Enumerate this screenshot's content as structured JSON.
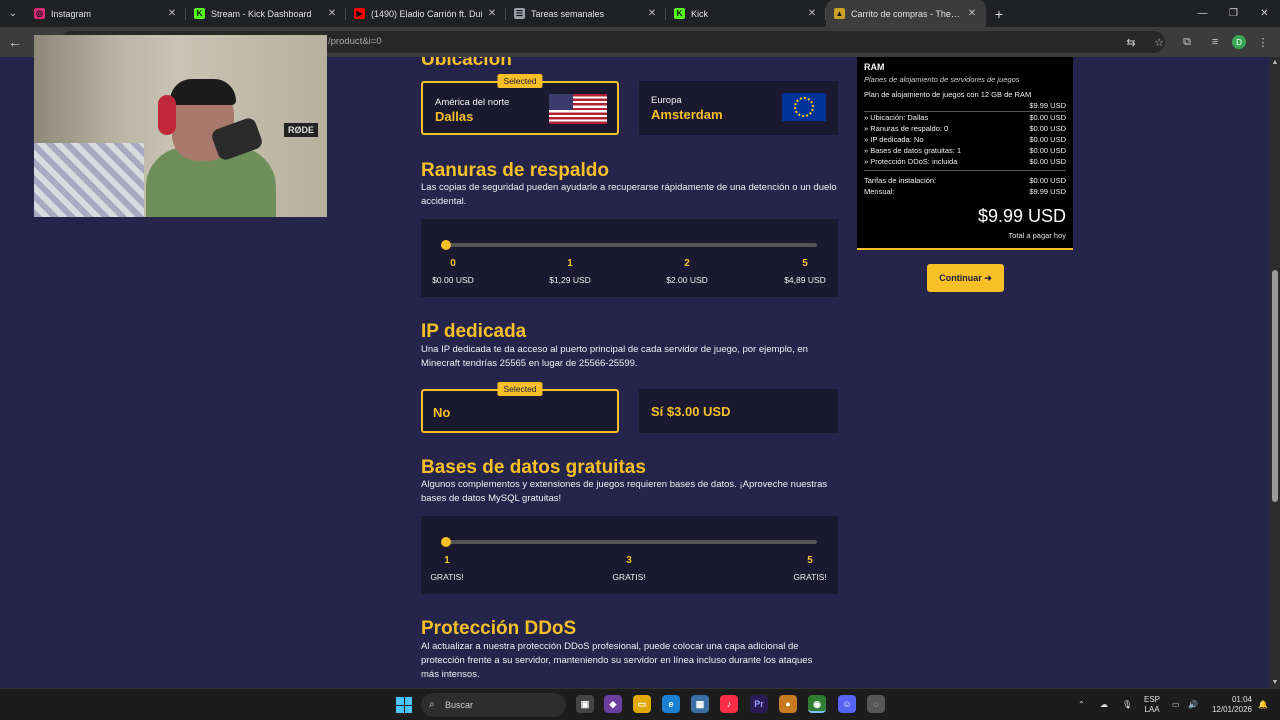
{
  "browser": {
    "tabs": [
      {
        "title": "Instagram",
        "favicon_color": "#d62976",
        "favicon_glyph": "◎",
        "active": false
      },
      {
        "title": "Stream - Kick Dashboard",
        "favicon_color": "#53fc18",
        "favicon_glyph": "K",
        "active": false
      },
      {
        "title": "(1490) Eladio Carrión ft. Dui",
        "favicon_color": "#ff0000",
        "favicon_glyph": "▶",
        "active": false
      },
      {
        "title": "Tareas semanales",
        "favicon_color": "#9aa0a6",
        "favicon_glyph": "☰",
        "active": false
      },
      {
        "title": "Kick",
        "favicon_color": "#53fc18",
        "favicon_glyph": "K",
        "active": false
      },
      {
        "title": "Carrito de compras - TheGame",
        "favicon_color": "#c9a227",
        "favicon_glyph": "▲",
        "active": true
      }
    ],
    "url": "/product&i=0",
    "profile_initial": "D"
  },
  "ubicacion": {
    "heading": "Ubicación",
    "selected_badge": "Selected",
    "options": [
      {
        "region": "América del norte",
        "city": "Dallas",
        "flag": "us-flag",
        "selected": true
      },
      {
        "region": "Europa",
        "city": "Amsterdam",
        "flag": "eu-flag",
        "selected": false
      }
    ]
  },
  "respaldo": {
    "heading": "Ranuras de respaldo",
    "description": "Las copias de seguridad pueden ayudarle a recuperarse rápidamente de una detención o un duelo accidental.",
    "selected_value": "0",
    "ticks": [
      {
        "num": "0",
        "price": "$0.00 USD"
      },
      {
        "num": "1",
        "price": "$1,29 USD"
      },
      {
        "num": "2",
        "price": "$2.00 USD"
      },
      {
        "num": "5",
        "price": "$4,89 USD"
      }
    ]
  },
  "ip": {
    "heading": "IP dedicada",
    "description": "Una IP dedicada te da acceso al puerto principal de cada servidor de juego, por ejemplo, en Minecraft tendrías 25565 en lugar de 25566-25599.",
    "selected_badge": "Selected",
    "options": [
      {
        "label": "No",
        "selected": true
      },
      {
        "label": "Sí $3.00 USD",
        "selected": false
      }
    ]
  },
  "bases": {
    "heading": "Bases de datos gratuitas",
    "description": "Algunos complementos y extensiones de juegos requieren bases de datos. ¡Aproveche nuestras bases de datos MySQL gratuitas!",
    "selected_value": "1",
    "ticks": [
      {
        "num": "1",
        "price": "GRATIS!"
      },
      {
        "num": "3",
        "price": "GRATIS!"
      },
      {
        "num": "5",
        "price": "GRATIS!"
      }
    ]
  },
  "ddos": {
    "heading": "Protección DDoS",
    "description": "Al actualizar a nuestra protección DDoS profesional, puede colocar una capa adicional de protección frente a su servidor, manteniendo su servidor en línea incluso durante los ataques más intensos."
  },
  "summary": {
    "ram": "RAM",
    "subtitle": "Planes de alojamiento de servidores de juegos",
    "plan": "Plan de alojamiento de juegos con 12 GB de RAM",
    "plan_price": "$9.99 USD",
    "items": [
      {
        "label": "» Ubicación: Dallas",
        "price": "$0.00 USD"
      },
      {
        "label": "» Ranuras de respaldo: 0",
        "price": "$0.00 USD"
      },
      {
        "label": "» IP dedicada: No",
        "price": "$0.00 USD"
      },
      {
        "label": "» Bases de datos gratuitas: 1",
        "price": "$0.00 USD"
      },
      {
        "label": "» Protección DDoS: incluida",
        "price": "$0.00 USD"
      }
    ],
    "setup_label": "Tarifas de instalación:",
    "setup_price": "$0.00 USD",
    "monthly_label": "Mensual:",
    "monthly_price": "$9.99 USD",
    "total": "$9.99 USD",
    "total_label": "Total a pagar hoy",
    "continue_label": "Continuar ➜"
  },
  "webcam": {
    "mic_brand": "RØDE"
  },
  "taskbar": {
    "search_placeholder": "Buscar",
    "lang_top": "ESP",
    "lang_bottom": "LAA",
    "time": "01:04",
    "date": "12/01/2026"
  },
  "colors": {
    "accent": "#f6c026",
    "page_bg": "#25244a",
    "card_bg": "#1a1930"
  }
}
